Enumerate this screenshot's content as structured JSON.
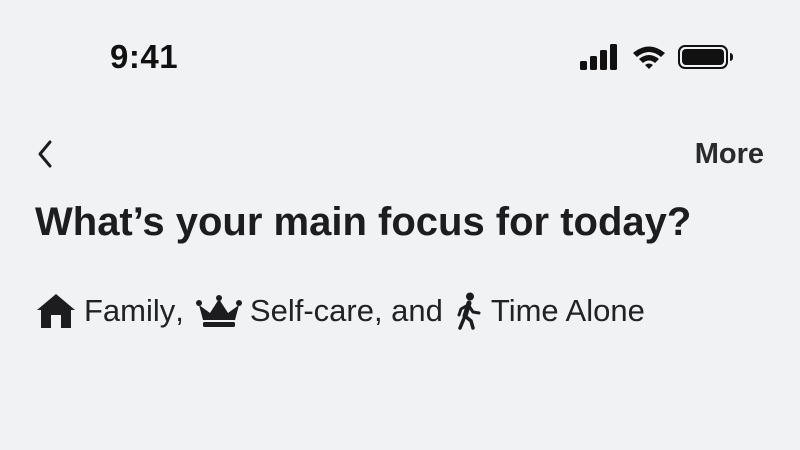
{
  "status_bar": {
    "time": "9:41",
    "icons": [
      "cellular-signal-icon",
      "wifi-icon",
      "battery-icon"
    ]
  },
  "nav": {
    "back_icon": "chevron-left-icon",
    "more_label": "More"
  },
  "page": {
    "title": "What’s your main focus for today?"
  },
  "focus": {
    "items": [
      {
        "icon": "house-icon",
        "label": "Family",
        "separator": ","
      },
      {
        "icon": "crown-icon",
        "label": "Self-care",
        "separator": ", and"
      },
      {
        "icon": "walking-person-icon",
        "label": "Time Alone",
        "separator": ""
      }
    ]
  },
  "colors": {
    "background": "#f1f2f4",
    "text": "#1d1d1f"
  }
}
